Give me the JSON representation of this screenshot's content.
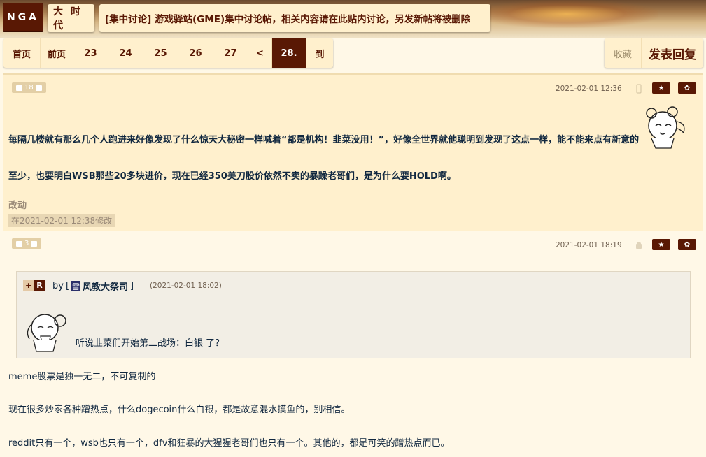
{
  "header": {
    "logo": "NGA",
    "forum": "大 时 代",
    "topic": "[集中讨论] 游戏驿站(GME)集中讨论帖，相关内容请在此贴内讨论，另发新帖将被删除"
  },
  "pager": {
    "first": "首页",
    "prev": "前页",
    "pages": [
      "23",
      "24",
      "25",
      "26",
      "27"
    ],
    "ellipsis": "<",
    "current": "28.",
    "goto": "到"
  },
  "actions": {
    "favorite": "收藏",
    "reply": "发表回复"
  },
  "posts": [
    {
      "likes": "18",
      "date": "2021-02-01 12:36",
      "lines": [
        "每隔几楼就有那么几个人跑进来好像发现了什么惊天大秘密一样喊着“都是机构！韭菜没用！”，好像全世界就他聪明到发现了这点一样，能不能来点有新意的",
        "至少，也要明白WSB那些20多块进价，现在已经350美刀股价依然不卖的暴躁老哥们，是为什么要HOLD啊。"
      ],
      "edit_label": "改动",
      "edit_time": "在2021-02-01 12:38修改"
    },
    {
      "likes": "3",
      "date": "2021-02-01 18:19",
      "quote": {
        "plus": "+",
        "r": "R",
        "by": "by",
        "user_badge": "雪",
        "user": "风教大祭司",
        "date": "(2021-02-01 18:02)",
        "text": "听说韭菜们开始第二战场：白银 了？"
      },
      "lines": [
        "meme股票是独一无二，不可复制的",
        "现在很多炒家各种蹭热点，什么dogecoin什么白银，都是故意混水摸鱼的，别相信。",
        "reddit只有一个，wsb也只有一个，dfv和狂暴的大猩猩老哥们也只有一个。其他的，都是可笑的蹭热点而已。"
      ]
    }
  ],
  "colors": {
    "brand": "#591804",
    "panel": "#fff0cd",
    "text": "#10273f"
  }
}
